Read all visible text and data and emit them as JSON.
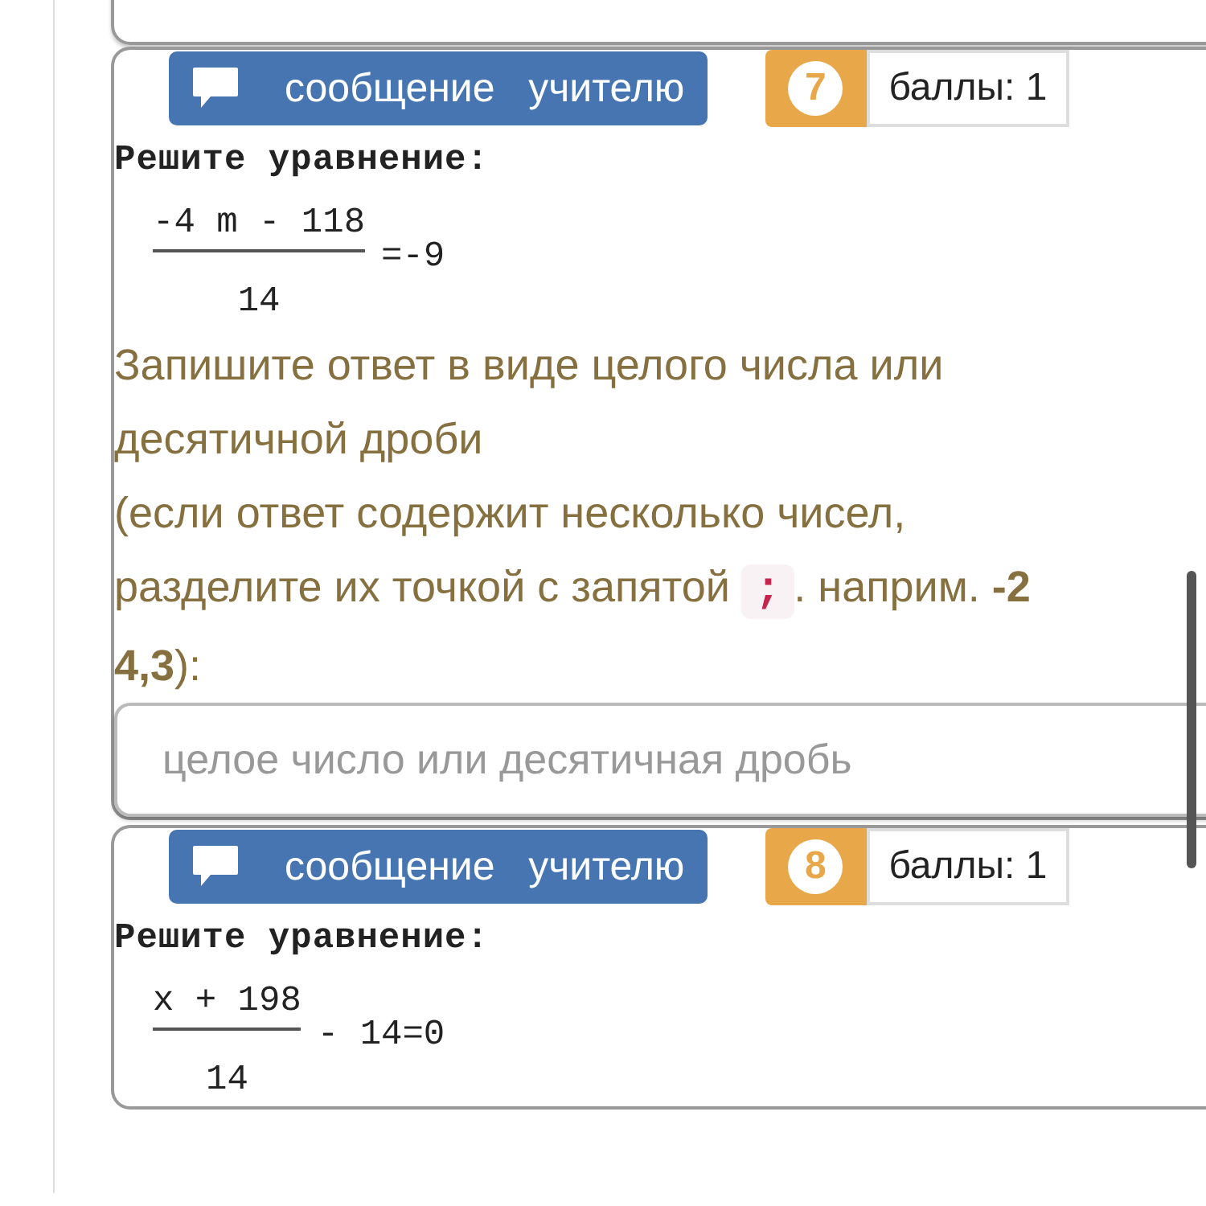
{
  "top_field": {
    "kind": "field"
  },
  "tasks": [
    {
      "message_button": "сообщение   учителю",
      "number": "7",
      "points": "баллы: 1",
      "prompt": "Решите уравнение:",
      "equation": {
        "numerator": "-4 m - 118",
        "denominator": "14",
        "rest": "=-9"
      },
      "hint": {
        "before": [
          "Запишите ответ в виде целого числа или",
          "десятичной дроби",
          "(если ответ содержит несколько чисел,",
          "разделите их точкой с запятой "
        ],
        "code": ";",
        "after": [
          ". наприм. **-2**",
          "**4,3**):"
        ]
      },
      "answer": {
        "placeholder": "целое число или десятичная дробь"
      }
    },
    {
      "message_button": "сообщение   учителю",
      "number": "8",
      "points": "баллы: 1",
      "prompt": "Решите уравнение:",
      "equation": {
        "numerator": "x + 198",
        "denominator": "14",
        "rest": "- 14=0"
      }
    }
  ]
}
